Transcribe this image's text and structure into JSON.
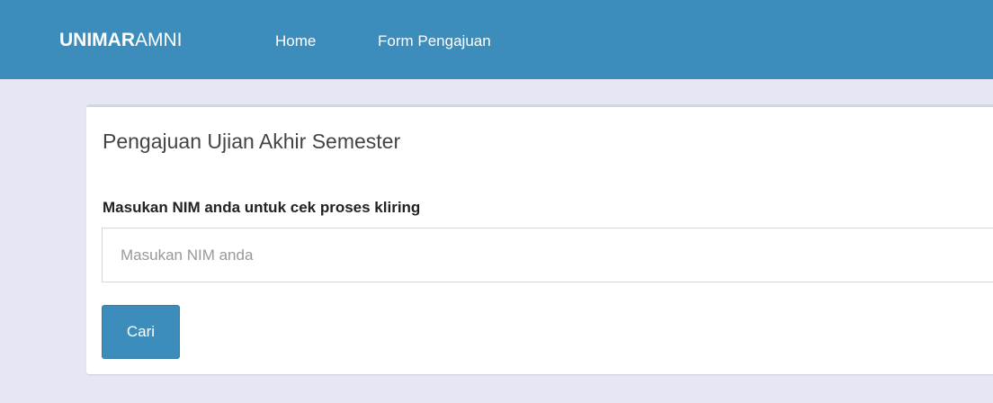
{
  "navbar": {
    "brand_bold": "UNIMAR",
    "brand_light": "AMNI",
    "links": [
      {
        "label": "Home"
      },
      {
        "label": "Form Pengajuan"
      }
    ]
  },
  "card": {
    "title": "Pengajuan Ujian Akhir Semester",
    "form": {
      "label": "Masukan NIM anda untuk cek proses kliring",
      "input_value": "",
      "input_placeholder": "Masukan NIM anda",
      "submit_label": "Cari"
    }
  },
  "colors": {
    "navbar_bg": "#3c8dbc",
    "page_bg": "#e6e6f5",
    "button_bg": "#3c8dbc"
  }
}
